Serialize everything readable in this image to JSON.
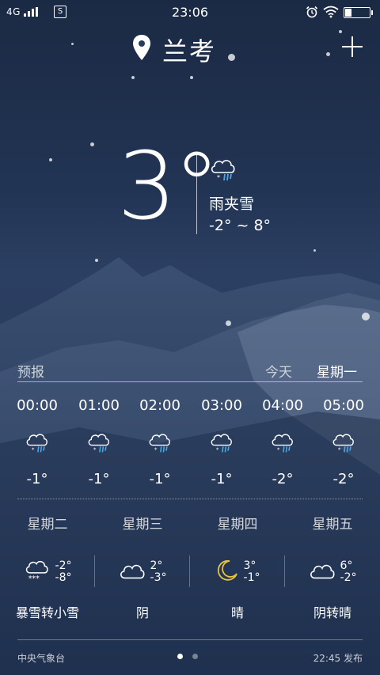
{
  "status_bar": {
    "network": "4G",
    "time": "23:06",
    "s_icon": "S"
  },
  "header": {
    "city": "兰考",
    "location_icon": "location-pin-icon",
    "add_icon": "plus-icon"
  },
  "current": {
    "temperature": "3°",
    "condition": "雨夹雪",
    "range": "-2° ~ 8°",
    "icon": "sleet-icon"
  },
  "forecast": {
    "label": "预报",
    "today": "今天",
    "day": "星期一",
    "hourly": [
      {
        "time": "00:00",
        "temp": "-1°",
        "icon": "sleet-icon"
      },
      {
        "time": "01:00",
        "temp": "-1°",
        "icon": "sleet-icon"
      },
      {
        "time": "02:00",
        "temp": "-1°",
        "icon": "sleet-icon"
      },
      {
        "time": "03:00",
        "temp": "-1°",
        "icon": "sleet-icon"
      },
      {
        "time": "04:00",
        "temp": "-2°",
        "icon": "sleet-icon"
      },
      {
        "time": "05:00",
        "temp": "-2°",
        "icon": "sleet-icon"
      }
    ],
    "daily": [
      {
        "day": "星期二",
        "high": "-2°",
        "low": "-8°",
        "condition": "暴雪转小雪",
        "icon": "heavy-snow-icon"
      },
      {
        "day": "星期三",
        "high": "2°",
        "low": "-3°",
        "condition": "阴",
        "icon": "cloud-icon"
      },
      {
        "day": "星期四",
        "high": "3°",
        "low": "-1°",
        "condition": "晴",
        "icon": "moon-icon"
      },
      {
        "day": "星期五",
        "high": "6°",
        "low": "-2°",
        "condition": "阴转晴",
        "icon": "cloud-icon"
      }
    ]
  },
  "footer": {
    "source": "中央气象台",
    "published": "22:45 发布",
    "page_count": 2,
    "active_page": 1
  },
  "colors": {
    "moon": "#e8c53a",
    "rain": "#4aa8e8"
  }
}
